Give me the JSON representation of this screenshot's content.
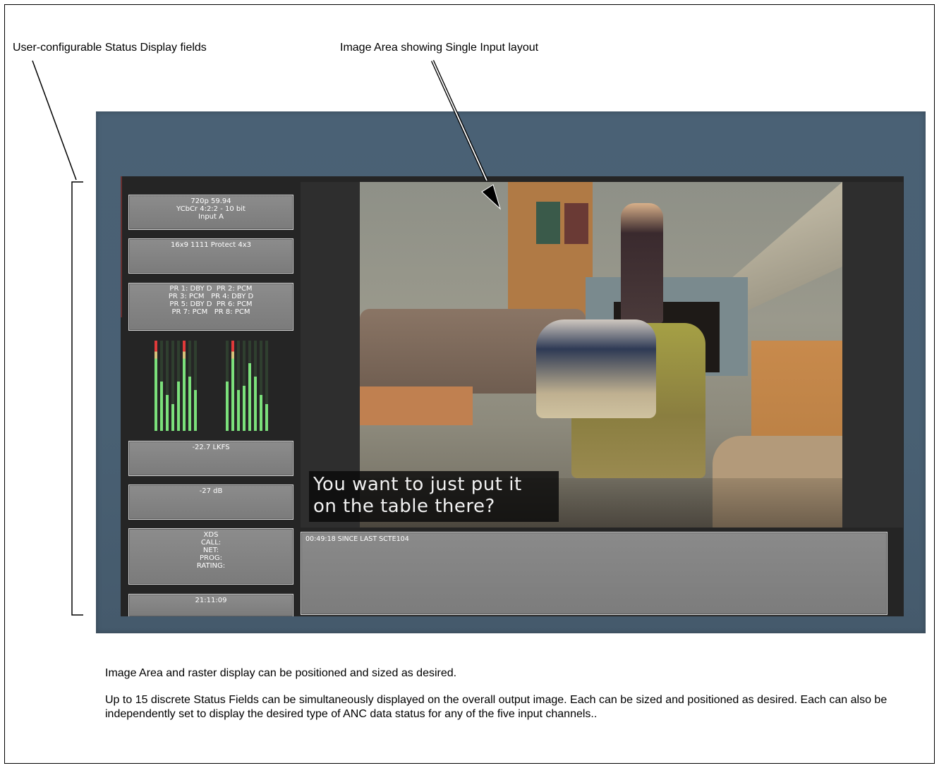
{
  "callouts": {
    "status_fields": "User-configurable Status Display fields",
    "image_area": "Image Area showing Single Input layout"
  },
  "status_fields": {
    "format": [
      "720p 59.94",
      "YCbCr 4:2:2 - 10 bit",
      "Input A"
    ],
    "afd": "16x9 1111 Protect 4x3",
    "audio_pairs": [
      "PR 1: DBY D  PR 2: PCM",
      "PR 3: PCM   PR 4: DBY D",
      "PR 5: DBY D  PR 6: PCM",
      "PR 7: PCM   PR 8: PCM"
    ],
    "loudness": "-22.7 LKFS",
    "level": "-27 dB",
    "xds": [
      "XDS",
      "CALL:",
      "NET:",
      "PROG:",
      "RATING:"
    ],
    "time": "21:11:09"
  },
  "meters": {
    "levels": [
      1.0,
      0.55,
      0.4,
      0.3,
      0.55,
      1.0,
      0.6,
      0.45,
      0.55,
      1.0,
      0.45,
      0.5,
      0.75,
      0.6,
      0.4,
      0.3
    ],
    "colors": {
      "green": "#7be07b",
      "dim_green": "#3f7d3f",
      "amber": "#d6c27a",
      "red": "#e03a3a"
    }
  },
  "image_area": {
    "caption": [
      "You want to just put it",
      "on the table there?"
    ]
  },
  "scte_field": {
    "text": "00:49:18  SINCE LAST SCTE104"
  },
  "description": {
    "line1": "Image Area and raster display can be positioned and sized as desired.",
    "line2": "Up to 15 discrete Status Fields can be simultaneously displayed on the overall output image. Each can be sized and positioned as desired. Each can also be independently set to display the desired type of ANC data status for any of the five input channels.."
  },
  "colors": {
    "outer_panel": "#4a6175",
    "raster_bg": "#252525",
    "field_bg": "#858585",
    "field_border": "#d4d4d4"
  }
}
